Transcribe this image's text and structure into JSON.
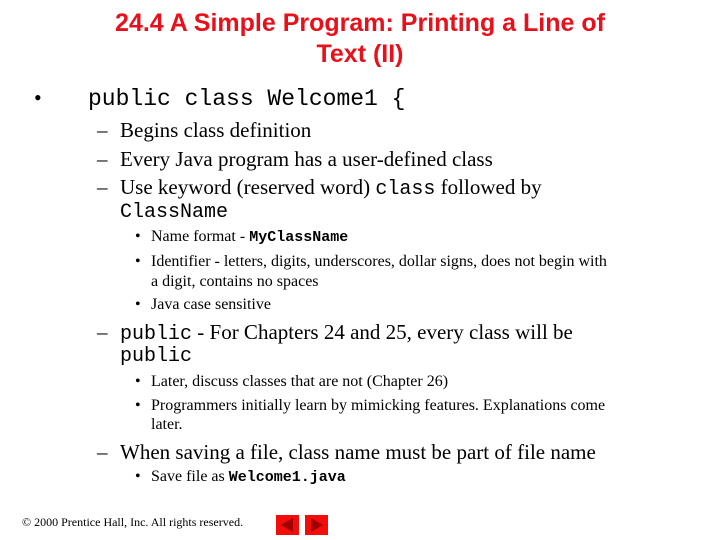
{
  "slide": {
    "title_line1": "24.4  A Simple Program: Printing a Line of",
    "title_line2": "Text (II)",
    "bullet1": {
      "code": "public class Welcome1 {",
      "items": [
        {
          "text": "Begins class definition"
        },
        {
          "text": "Every Java program has a user-defined class"
        },
        {
          "text_pre": "Use keyword (reserved word) ",
          "code": "class",
          "text_post": " followed by",
          "code2": "ClassName"
        }
      ],
      "sub_items": [
        {
          "text": "Name format - ",
          "code": "MyClassName"
        },
        {
          "text": "Identifier - letters, digits, underscores, dollar signs, does not begin with",
          "text2": "a digit, contains no spaces"
        },
        {
          "text": "Java case sensitive"
        }
      ],
      "public_item": {
        "code": "public",
        "text": " - For Chapters 24 and 25, every class will be",
        "code2": "public"
      },
      "public_sub": [
        {
          "text": "Later, discuss classes that are not (Chapter 26)"
        },
        {
          "text": "Programmers initially learn by mimicking features.  Explanations come",
          "text2": "later."
        }
      ],
      "save_item": {
        "text": "When saving a file, class name must be part of file name"
      },
      "save_sub": {
        "text": "Save file as ",
        "code": "Welcome1.java"
      }
    },
    "markers": {
      "bullet": "•",
      "dash": "–"
    }
  },
  "footer": {
    "copyright_symbol": "©",
    "copyright": " 2000 Prentice Hall, Inc.  All rights reserved."
  },
  "nav": {
    "prev": "previous-slide",
    "next": "next-slide"
  }
}
